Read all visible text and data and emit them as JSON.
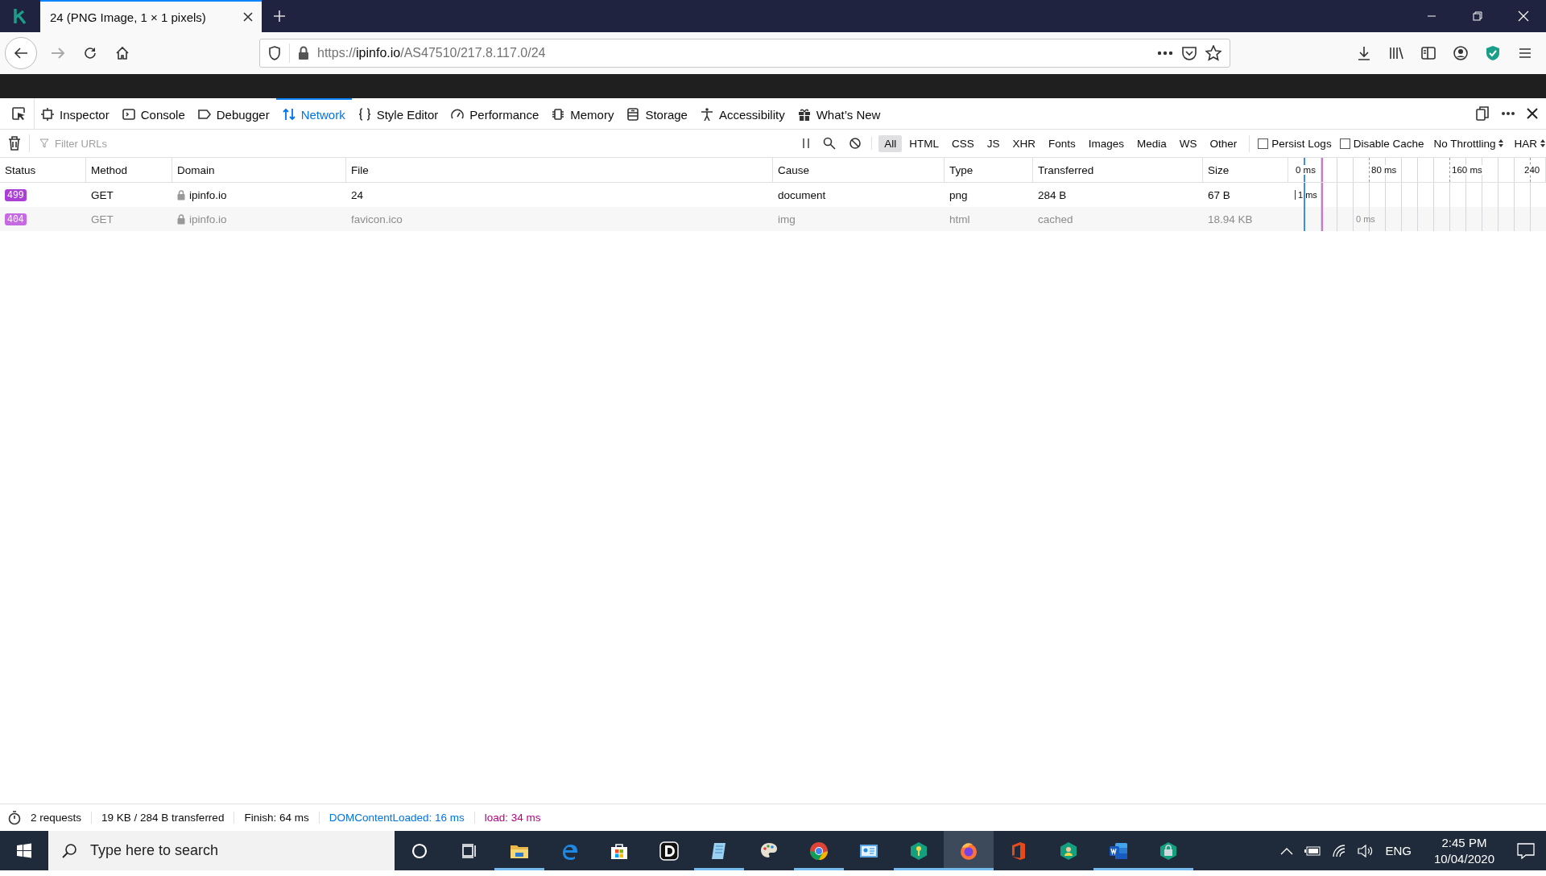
{
  "browser_tab": {
    "title": "24 (PNG Image, 1 × 1 pixels)",
    "selected": true
  },
  "url": {
    "scheme": "https://",
    "host": "ipinfo.io",
    "path": "/AS47510/217.8.117.0/24"
  },
  "devtools_tabs": [
    {
      "label": "Inspector",
      "kind": "inspector",
      "selected": false
    },
    {
      "label": "Console",
      "kind": "console",
      "selected": false
    },
    {
      "label": "Debugger",
      "kind": "debugger",
      "selected": false
    },
    {
      "label": "Network",
      "kind": "network",
      "selected": true
    },
    {
      "label": "Style Editor",
      "kind": "style",
      "selected": false
    },
    {
      "label": "Performance",
      "kind": "performance",
      "selected": false
    },
    {
      "label": "Memory",
      "kind": "memory",
      "selected": false
    },
    {
      "label": "Storage",
      "kind": "storage",
      "selected": false
    },
    {
      "label": "Accessibility",
      "kind": "accessibility",
      "selected": false
    },
    {
      "label": "What’s New",
      "kind": "gift",
      "selected": false
    }
  ],
  "filter": {
    "placeholder": "Filter URLs"
  },
  "type_filters": [
    {
      "label": "All",
      "selected": true
    },
    {
      "label": "HTML",
      "selected": false
    },
    {
      "label": "CSS",
      "selected": false
    },
    {
      "label": "JS",
      "selected": false
    },
    {
      "label": "XHR",
      "selected": false
    },
    {
      "label": "Fonts",
      "selected": false
    },
    {
      "label": "Images",
      "selected": false
    },
    {
      "label": "Media",
      "selected": false
    },
    {
      "label": "WS",
      "selected": false
    },
    {
      "label": "Other",
      "selected": false
    }
  ],
  "options": [
    {
      "label": "Persist Logs",
      "checked": false
    },
    {
      "label": "Disable Cache",
      "checked": false
    }
  ],
  "throttling": "No Throttling",
  "har": "HAR",
  "table": {
    "columns": [
      "Status",
      "Method",
      "Domain",
      "File",
      "Cause",
      "Type",
      "Transferred",
      "Size"
    ],
    "timeline_ticks": [
      "0 ms",
      "80 ms",
      "160 ms",
      "240"
    ],
    "rows": [
      {
        "status": "499",
        "color": "#a93fd4",
        "method": "GET",
        "domain": "ipinfo.io",
        "file": "24",
        "cause": "document",
        "type": "png",
        "transferred": "284 B",
        "size": "67 B",
        "timing": "1 ms",
        "cached": false
      },
      {
        "status": "404",
        "color": "#c56ae3",
        "method": "GET",
        "domain": "ipinfo.io",
        "file": "favicon.ico",
        "cause": "img",
        "type": "html",
        "transferred": "cached",
        "size": "18.94 KB",
        "timing": "0 ms",
        "cached": true
      }
    ]
  },
  "status_bar": {
    "requests": "2 requests",
    "transferred": "19 KB / 284 B transferred",
    "finish": "Finish: 64 ms",
    "dom_loaded": "DOMContentLoaded: 16 ms",
    "load": "load: 34 ms"
  },
  "taskbar": {
    "search_placeholder": "Type here to search",
    "apps": [
      {
        "kind": "cortana",
        "running": false,
        "active": false
      },
      {
        "kind": "taskview",
        "running": false,
        "active": false
      },
      {
        "kind": "folder",
        "running": true,
        "active": false
      },
      {
        "kind": "edge",
        "running": false,
        "active": false
      },
      {
        "kind": "store",
        "running": false,
        "active": false
      },
      {
        "kind": "dapp",
        "running": false,
        "active": false
      },
      {
        "kind": "notepad",
        "running": true,
        "active": false
      },
      {
        "kind": "palette",
        "running": false,
        "active": false
      },
      {
        "kind": "chrome",
        "running": true,
        "active": false
      },
      {
        "kind": "card",
        "running": false,
        "active": false
      },
      {
        "kind": "key",
        "running": true,
        "active": false
      },
      {
        "kind": "firefox",
        "running": true,
        "active": true
      },
      {
        "kind": "office",
        "running": false,
        "active": false
      },
      {
        "kind": "person",
        "running": false,
        "active": false
      },
      {
        "kind": "word",
        "running": true,
        "active": false
      },
      {
        "kind": "lock",
        "running": true,
        "active": false
      }
    ],
    "language": "ENG",
    "time": "2:45 PM",
    "date": "10/04/2020"
  }
}
